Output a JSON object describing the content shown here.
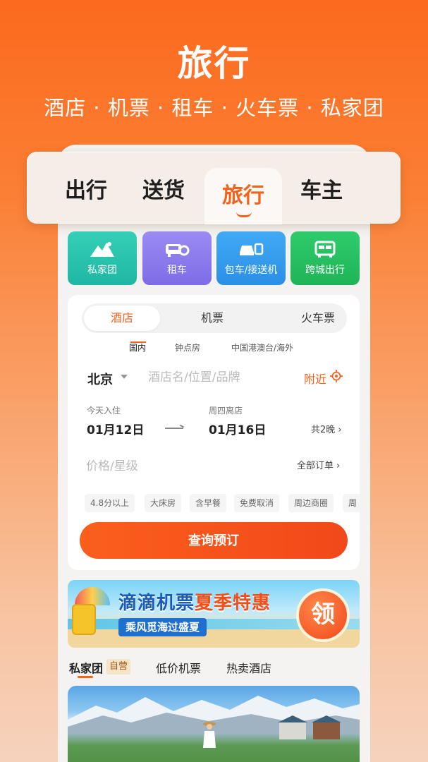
{
  "hero": {
    "title": "旅行",
    "subtitle": "酒店 · 机票 · 租车 · 火车票 · 私家团"
  },
  "top_tabs": [
    {
      "label": "出行",
      "active": false
    },
    {
      "label": "送货",
      "active": false
    },
    {
      "label": "旅行",
      "active": true
    },
    {
      "label": "车主",
      "active": false
    }
  ],
  "service_tiles": [
    {
      "label": "私家团",
      "icon": "mountain-icon",
      "color": "#1fb7a3"
    },
    {
      "label": "租车",
      "icon": "car-key-icon",
      "color": "#7d6ce6"
    },
    {
      "label": "包车/接送机",
      "icon": "car-package-icon",
      "color": "#2b8fe6"
    },
    {
      "label": "跨城出行",
      "icon": "intercity-car-icon",
      "color": "#1fb457"
    }
  ],
  "booking": {
    "segments": [
      "酒店",
      "机票",
      "火车票"
    ],
    "active_segment": "酒店",
    "subtabs": [
      "国内",
      "钟点房",
      "中国港澳台/海外"
    ],
    "active_subtab": "国内",
    "city": "北京",
    "search_placeholder": "酒店名/位置/品牌",
    "nearby": "附近",
    "checkin_label": "今天入住",
    "checkin_date": "01月12日",
    "checkout_label": "周四离店",
    "checkout_date": "01月16日",
    "nights": "共2晚 ›",
    "price_placeholder": "价格/星级",
    "all_orders": "全部订单 ›",
    "chips": [
      "4.8分以上",
      "大床房",
      "含早餐",
      "免费取消",
      "周边商圈",
      "周"
    ],
    "submit": "查询预订"
  },
  "banner": {
    "title_a": "滴滴机票",
    "title_b": "夏季特惠",
    "subtitle": "乘风觅海过盛夏",
    "claim": "领"
  },
  "feed_tabs": {
    "tab1": "私家团",
    "badge": "自营",
    "tab2": "低价机票",
    "tab3": "热卖酒店"
  },
  "colors": {
    "accent": "#f4621c",
    "gradient_top": "#fb6a1e"
  }
}
